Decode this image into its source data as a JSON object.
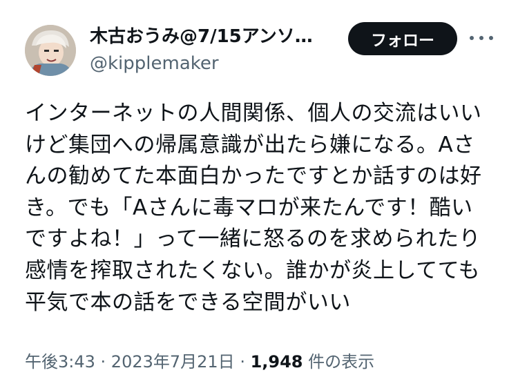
{
  "author": {
    "display_name": "木古おうみ@7/15アンソ…",
    "handle": "@kipplemaker"
  },
  "header": {
    "follow_label": "フォロー"
  },
  "tweet": {
    "lines": [
      "インターネットの人間関係、個人の交流はいい",
      "けど集団への帰属意識が出たら嫌になる。Aさ",
      "んの勧めてた本面白かったですとか話すのは好",
      "き。でも「Aさんに毒マロが来たんです！酷い",
      "ですよね！」って一緒に怒るのを求められたり",
      "感情を搾取されたくない。誰かが炎上してても",
      "平気で本の話をできる空間がいい"
    ]
  },
  "meta": {
    "time": "午後3:43",
    "separator": " · ",
    "date": "2023年7月21日",
    "views_count": "1,948",
    "views_label": " 件の表示"
  }
}
